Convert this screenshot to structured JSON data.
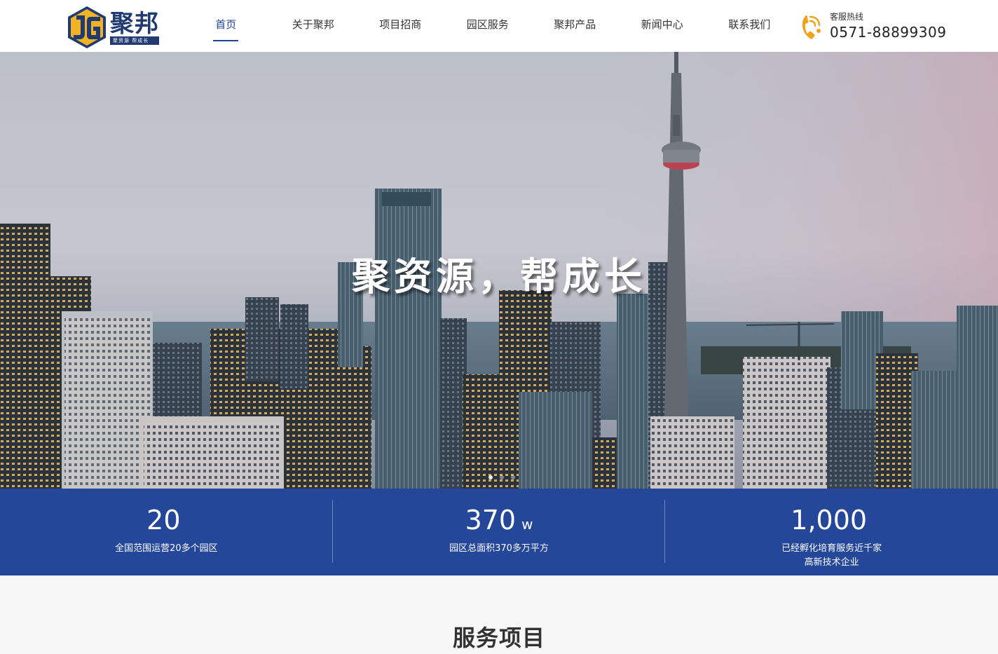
{
  "brand": {
    "name": "聚邦",
    "slogan": "聚资源 帮成长",
    "colors": {
      "primary": "#213a72",
      "gold": "#f0b323",
      "accent": "#234496"
    }
  },
  "nav": {
    "items": [
      {
        "label": "首页",
        "active": true
      },
      {
        "label": "关于聚邦",
        "active": false
      },
      {
        "label": "项目招商",
        "active": false
      },
      {
        "label": "园区服务",
        "active": false
      },
      {
        "label": "聚邦产品",
        "active": false
      },
      {
        "label": "新闻中心",
        "active": false
      },
      {
        "label": "联系我们",
        "active": false
      }
    ]
  },
  "hotline": {
    "icon": "phone-icon",
    "label": "客服热线",
    "phone": "0571-88899309"
  },
  "hero": {
    "title": "聚资源，帮成长",
    "slides": 3,
    "active_slide": 1
  },
  "stats": [
    {
      "number": "20",
      "unit": "",
      "desc": "全国范围运营20多个园区"
    },
    {
      "number": "370",
      "unit": "w",
      "desc": "园区总面积370多万平方"
    },
    {
      "number": "1,000",
      "unit": "",
      "desc": "已经孵化培育服务近千家\n高新技术企业"
    }
  ],
  "services": {
    "title": "服务项目"
  }
}
